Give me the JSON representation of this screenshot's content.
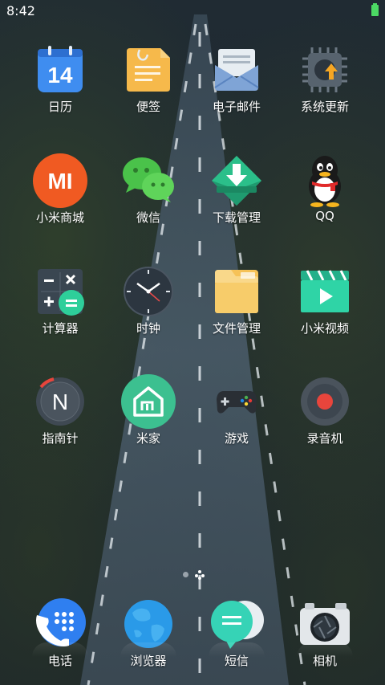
{
  "status_bar": {
    "time": "8:42"
  },
  "rows": [
    [
      {
        "label": "日历",
        "icon": "calendar-icon",
        "day": "14"
      },
      {
        "label": "便签",
        "icon": "notes-icon"
      },
      {
        "label": "电子邮件",
        "icon": "email-icon"
      },
      {
        "label": "系统更新",
        "icon": "system-update-icon"
      }
    ],
    [
      {
        "label": "小米商城",
        "icon": "mi-store-icon",
        "mi": "MI"
      },
      {
        "label": "微信",
        "icon": "wechat-icon"
      },
      {
        "label": "下载管理",
        "icon": "download-icon"
      },
      {
        "label": "QQ",
        "icon": "qq-icon"
      }
    ],
    [
      {
        "label": "计算器",
        "icon": "calculator-icon"
      },
      {
        "label": "时钟",
        "icon": "clock-icon"
      },
      {
        "label": "文件管理",
        "icon": "file-manager-icon"
      },
      {
        "label": "小米视频",
        "icon": "mi-video-icon"
      }
    ],
    [
      {
        "label": "指南针",
        "icon": "compass-icon",
        "letter": "N"
      },
      {
        "label": "米家",
        "icon": "mi-home-icon"
      },
      {
        "label": "游戏",
        "icon": "gamepad-icon"
      },
      {
        "label": "录音机",
        "icon": "recorder-icon"
      }
    ]
  ],
  "dock": [
    {
      "label": "电话",
      "icon": "phone-icon"
    },
    {
      "label": "浏览器",
      "icon": "browser-icon"
    },
    {
      "label": "短信",
      "icon": "messages-icon"
    },
    {
      "label": "相机",
      "icon": "camera-icon"
    }
  ],
  "colors": {
    "calendar": "#3f8df0",
    "notes": "#f6b94b",
    "mi_store": "#f05a22",
    "wechat": "#4ac24a",
    "download": "#2bbf8a",
    "qq": "#1a1a1a",
    "calculator": "#3a4651",
    "calc_accent": "#2ecf9a",
    "clock": "#2c3640",
    "files": "#f6c257",
    "mi_video": "#2fd4a6",
    "compass": "#3f4953",
    "mi_home": "#3cc090",
    "recorder": "#4a535c",
    "phone": "#2f7ff0",
    "browser": "#2a9ae8",
    "messages": "#36d3b6"
  }
}
